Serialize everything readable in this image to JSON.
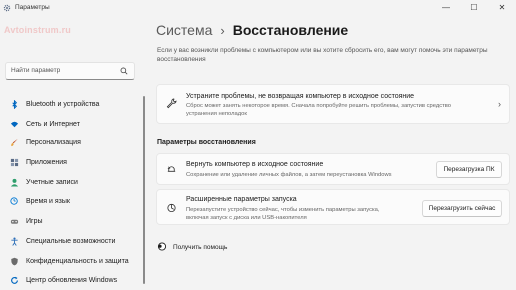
{
  "window": {
    "title": "Параметры",
    "minimize": "—",
    "maximize": "☐",
    "close": "✕"
  },
  "watermark": "Avtoinstrum.ru",
  "search": {
    "placeholder": "Найти параметр"
  },
  "sidebar": {
    "items": [
      {
        "label": "Bluetooth и устройства",
        "icon": "bluetooth-icon",
        "color": "#0067c0"
      },
      {
        "label": "Сеть и Интернет",
        "icon": "wifi-icon",
        "color": "#0067c0"
      },
      {
        "label": "Персонализация",
        "icon": "brush-icon",
        "color": "#c0562f"
      },
      {
        "label": "Приложения",
        "icon": "apps-icon",
        "color": "#5a6b85"
      },
      {
        "label": "Учетные записи",
        "icon": "person-icon",
        "color": "#2e9e6c"
      },
      {
        "label": "Время и язык",
        "icon": "globe-clock-icon",
        "color": "#0078d4"
      },
      {
        "label": "Игры",
        "icon": "gamepad-icon",
        "color": "#7a7a7a"
      },
      {
        "label": "Специальные возможности",
        "icon": "accessibility-icon",
        "color": "#2d6fb8"
      },
      {
        "label": "Конфиденциальность и защита",
        "icon": "shield-icon",
        "color": "#6b6b6b"
      },
      {
        "label": "Центр обновления Windows",
        "icon": "update-icon",
        "color": "#0067c0"
      }
    ]
  },
  "header": {
    "parent": "Система",
    "separator": "›",
    "current": "Восстановление"
  },
  "intro": "Если у вас возникли проблемы с компьютером или вы хотите сбросить его, вам могут помочь эти параметры восстановления",
  "troubleshoot": {
    "title": "Устраните проблемы, не возвращая компьютер в исходное состояние",
    "description": "Сброс может занять некоторое время. Сначала попробуйте решить проблемы, запустив средство устранения неполадок",
    "chevron": "›"
  },
  "recovery_section": {
    "title": "Параметры восстановления",
    "reset": {
      "title": "Вернуть компьютер в исходное состояние",
      "description": "Сохранение или удаление личных файлов, а затем переустановка Windows",
      "button": "Перезагрузка ПК"
    },
    "advanced": {
      "title": "Расширенные параметры запуска",
      "description": "Перезапустите устройство сейчас, чтобы изменить параметры запуска, включая запуск с диска или USB-накопителя",
      "button": "Перезагрузить сейчас"
    }
  },
  "help": {
    "label": "Получить помощь"
  }
}
